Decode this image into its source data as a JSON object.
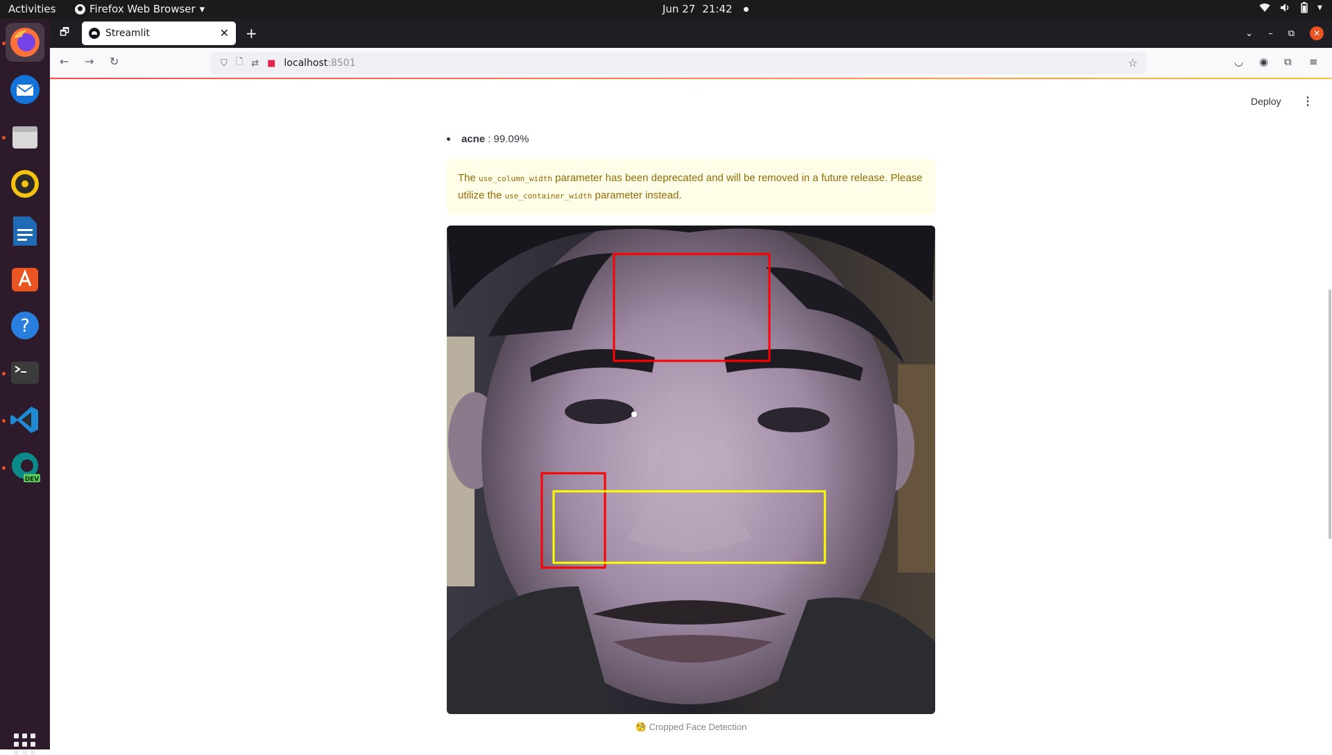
{
  "topbar": {
    "activities": "Activities",
    "app_menu": "Firefox Web Browser",
    "date": "Jun 27",
    "time": "21:42"
  },
  "dock": {
    "items": [
      {
        "name": "firefox",
        "icon": "firefox-icon",
        "running": true
      },
      {
        "name": "thunderbird",
        "icon": "thunderbird-icon",
        "running": false
      },
      {
        "name": "files",
        "icon": "files-icon",
        "running": true
      },
      {
        "name": "rhythmbox",
        "icon": "rhythmbox-icon",
        "running": false
      },
      {
        "name": "writer",
        "icon": "libreoffice-writer-icon",
        "running": false
      },
      {
        "name": "software",
        "icon": "app-center-icon",
        "running": false
      },
      {
        "name": "help",
        "icon": "help-icon",
        "running": false
      },
      {
        "name": "terminal",
        "icon": "terminal-icon",
        "running": true
      },
      {
        "name": "vscode",
        "icon": "vscode-icon",
        "running": true
      },
      {
        "name": "edge-dev",
        "icon": "edge-dev-icon",
        "running": true
      }
    ],
    "edge_badge": "DEV"
  },
  "browser": {
    "tab_title": "Streamlit",
    "url_host": "localhost",
    "url_port": ":8501"
  },
  "app": {
    "deploy_label": "Deploy",
    "result_label": "acne",
    "result_value": ": 99.09%",
    "warning": {
      "part1": "The ",
      "code1": "use_column_width",
      "part2": " parameter has been deprecated and will be removed in a future release. Please utilize the ",
      "code2": "use_container_width",
      "part3": " parameter instead."
    },
    "caption": "🧐 Cropped Face Detection",
    "detections": [
      {
        "color": "#ff0000",
        "label": "forehead"
      },
      {
        "color": "#ff0000",
        "label": "left-cheek"
      },
      {
        "color": "#ffff00",
        "label": "cheeks-band"
      }
    ]
  }
}
